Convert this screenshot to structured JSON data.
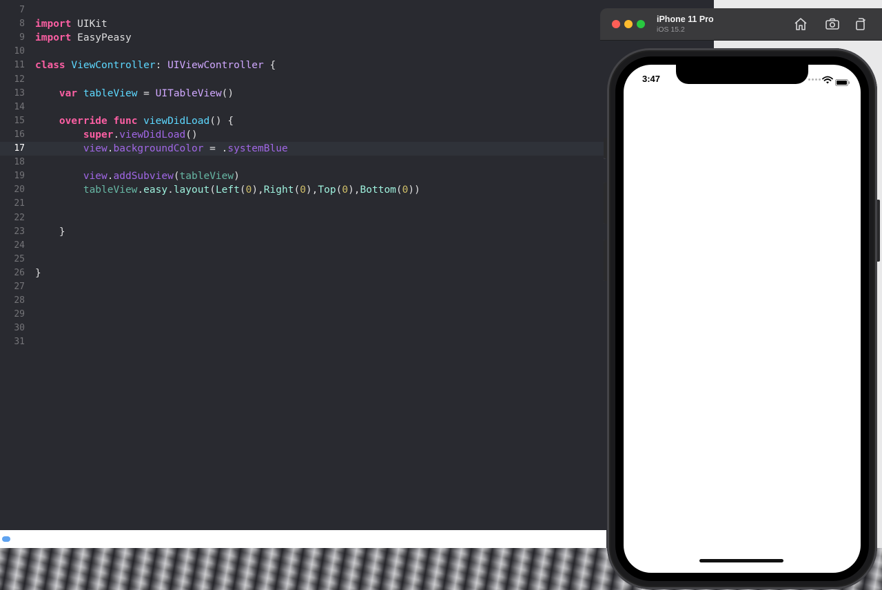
{
  "editor": {
    "lines": [
      {
        "num": "7",
        "tokens": []
      },
      {
        "num": "8",
        "tokens": [
          [
            "kw",
            "import"
          ],
          [
            "tplain",
            " UIKit"
          ]
        ]
      },
      {
        "num": "9",
        "tokens": [
          [
            "kw",
            "import"
          ],
          [
            "tplain",
            " EasyPeasy"
          ]
        ]
      },
      {
        "num": "10",
        "tokens": []
      },
      {
        "num": "11",
        "tokens": [
          [
            "kw",
            "class"
          ],
          [
            "tplain",
            " "
          ],
          [
            "tdecl",
            "ViewController"
          ],
          [
            "tplain",
            ": "
          ],
          [
            "ttype",
            "UIViewController"
          ],
          [
            "tplain",
            " {"
          ]
        ]
      },
      {
        "num": "12",
        "tokens": []
      },
      {
        "num": "13",
        "tokens": [
          [
            "tplain",
            "    "
          ],
          [
            "kw",
            "var"
          ],
          [
            "tplain",
            " "
          ],
          [
            "tdecl",
            "tableView"
          ],
          [
            "tplain",
            " = "
          ],
          [
            "ttype",
            "UITableView"
          ],
          [
            "tplain",
            "()"
          ]
        ]
      },
      {
        "num": "14",
        "tokens": []
      },
      {
        "num": "15",
        "tokens": [
          [
            "tplain",
            "    "
          ],
          [
            "kw",
            "override"
          ],
          [
            "tplain",
            " "
          ],
          [
            "kw",
            "func"
          ],
          [
            "tplain",
            " "
          ],
          [
            "tdecl",
            "viewDidLoad"
          ],
          [
            "tplain",
            "() {"
          ]
        ]
      },
      {
        "num": "16",
        "tokens": [
          [
            "tplain",
            "        "
          ],
          [
            "kw",
            "super"
          ],
          [
            "tplain",
            "."
          ],
          [
            "tfunc",
            "viewDidLoad"
          ],
          [
            "tplain",
            "()"
          ]
        ]
      },
      {
        "num": "17",
        "tokens": [
          [
            "tplain",
            "        "
          ],
          [
            "tprop",
            "view"
          ],
          [
            "tplain",
            "."
          ],
          [
            "tprop",
            "backgroundColor"
          ],
          [
            "tplain",
            " = ."
          ],
          [
            "tprop",
            "systemBlue"
          ]
        ],
        "current": true
      },
      {
        "num": "18",
        "tokens": []
      },
      {
        "num": "19",
        "tokens": [
          [
            "tplain",
            "        "
          ],
          [
            "tprop",
            "view"
          ],
          [
            "tplain",
            "."
          ],
          [
            "tfunc",
            "addSubview"
          ],
          [
            "tplain",
            "("
          ],
          [
            "tvar",
            "tableView"
          ],
          [
            "tplain",
            ")"
          ]
        ]
      },
      {
        "num": "20",
        "tokens": [
          [
            "tplain",
            "        "
          ],
          [
            "tvar",
            "tableView"
          ],
          [
            "tplain",
            "."
          ],
          [
            "tproj",
            "easy"
          ],
          [
            "tplain",
            "."
          ],
          [
            "tproj",
            "layout"
          ],
          [
            "tplain",
            "("
          ],
          [
            "tproj",
            "Left"
          ],
          [
            "tplain",
            "("
          ],
          [
            "tnum",
            "0"
          ],
          [
            "tplain",
            "),"
          ],
          [
            "tproj",
            "Right"
          ],
          [
            "tplain",
            "("
          ],
          [
            "tnum",
            "0"
          ],
          [
            "tplain",
            "),"
          ],
          [
            "tproj",
            "Top"
          ],
          [
            "tplain",
            "("
          ],
          [
            "tnum",
            "0"
          ],
          [
            "tplain",
            "),"
          ],
          [
            "tproj",
            "Bottom"
          ],
          [
            "tplain",
            "("
          ],
          [
            "tnum",
            "0"
          ],
          [
            "tplain",
            "))"
          ]
        ]
      },
      {
        "num": "21",
        "tokens": []
      },
      {
        "num": "22",
        "tokens": []
      },
      {
        "num": "23",
        "tokens": [
          [
            "tplain",
            "    }"
          ]
        ]
      },
      {
        "num": "24",
        "tokens": []
      },
      {
        "num": "25",
        "tokens": []
      },
      {
        "num": "26",
        "tokens": [
          [
            "tplain",
            "}"
          ]
        ]
      },
      {
        "num": "27",
        "tokens": []
      },
      {
        "num": "28",
        "tokens": []
      },
      {
        "num": "29",
        "tokens": []
      },
      {
        "num": "30",
        "tokens": []
      },
      {
        "num": "31",
        "tokens": []
      }
    ]
  },
  "simulator": {
    "device_name": "iPhone 11 Pro",
    "os_version": "iOS 15.2",
    "status_time": "3:47",
    "icons": [
      "home-icon",
      "screenshot-icon",
      "rotate-icon"
    ]
  },
  "colors": {
    "editor_bg": "#292a30",
    "keyword": "#fc5fa3",
    "declaration": "#5dd8ff",
    "type": "#d0a8ff",
    "property": "#a167e6",
    "number": "#d0bf69"
  }
}
